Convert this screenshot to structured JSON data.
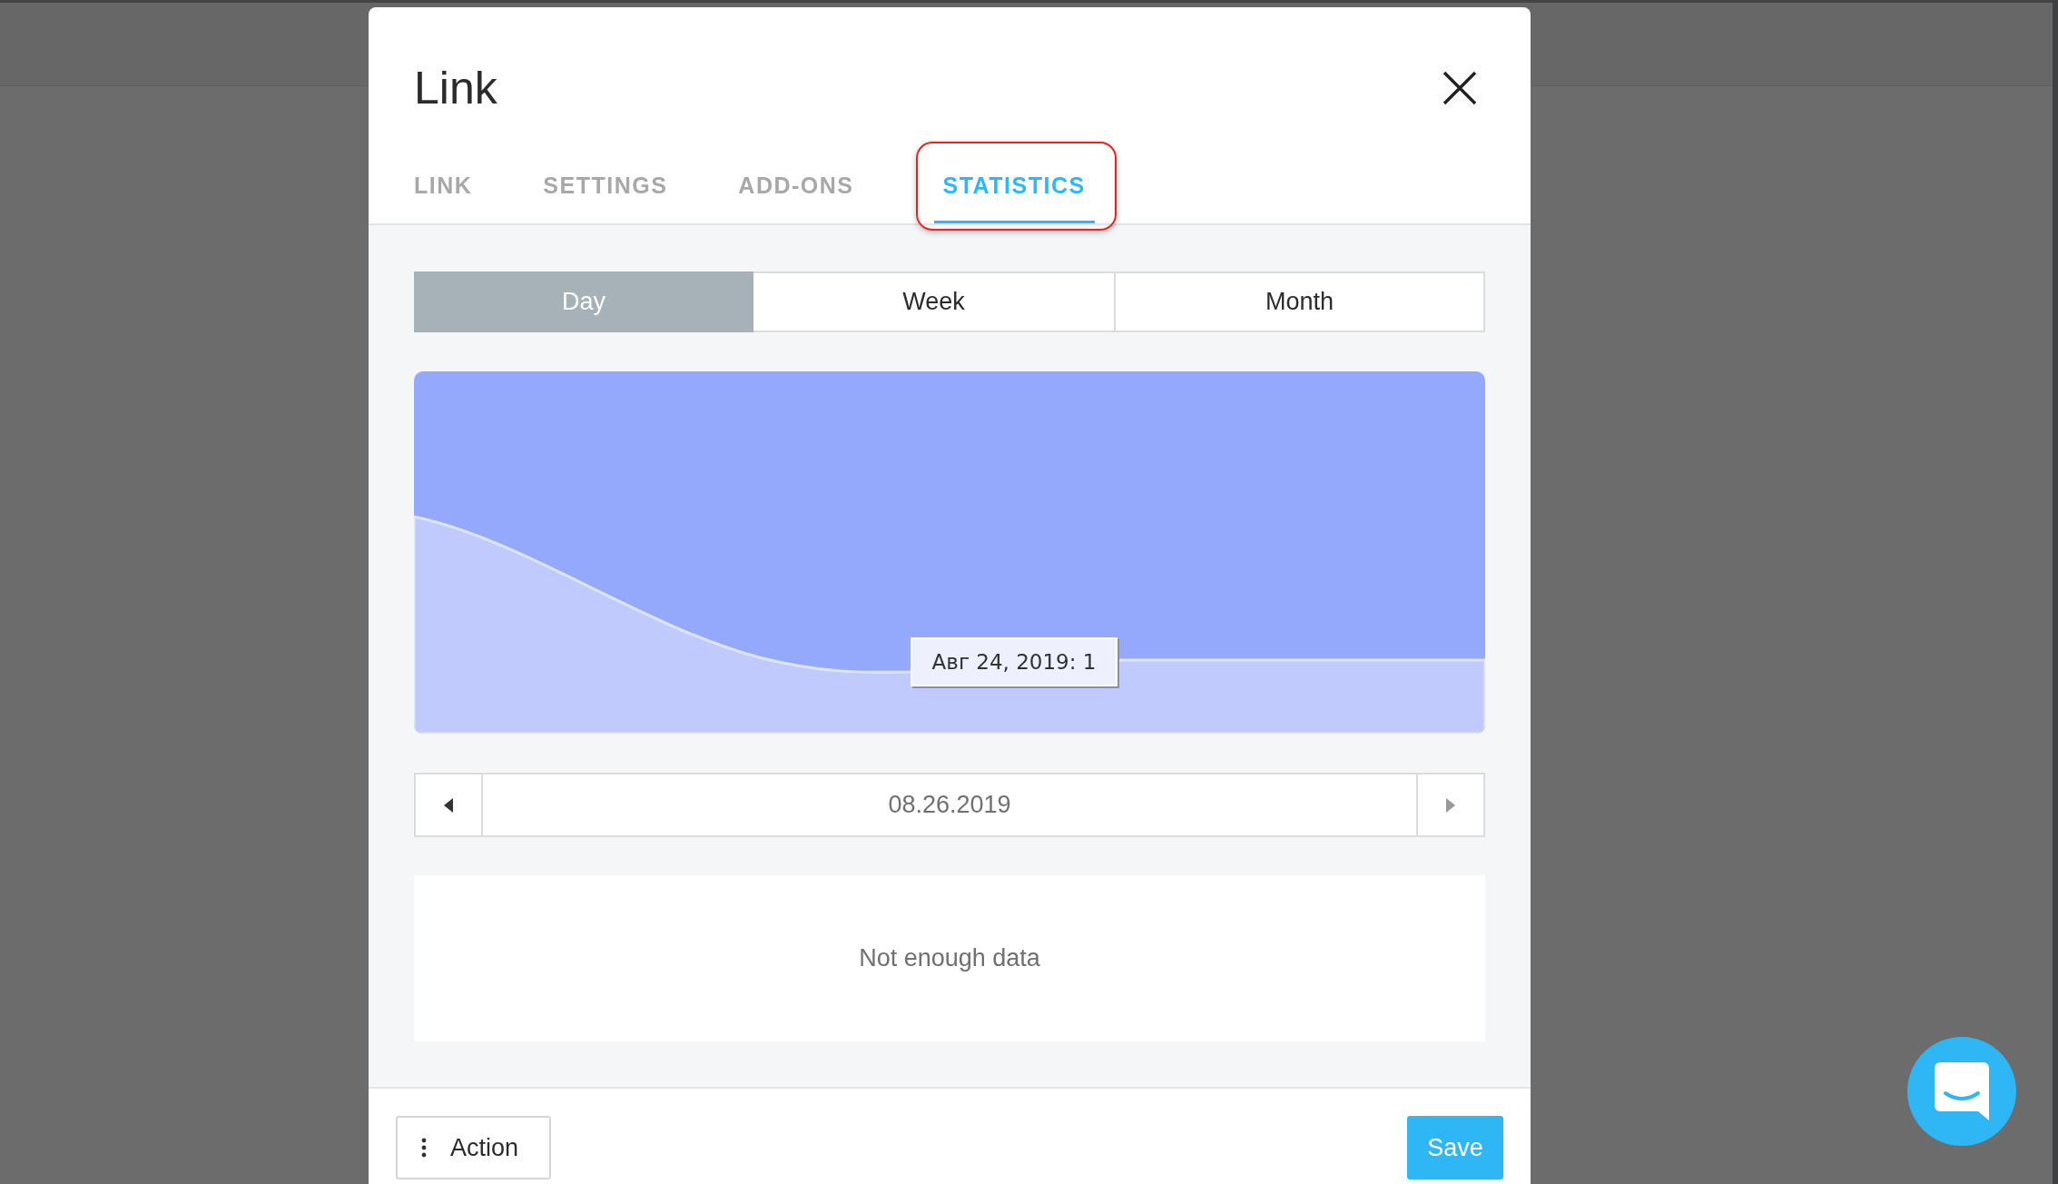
{
  "dialog": {
    "title": "Link"
  },
  "tabs": [
    {
      "label": "LINK",
      "selected": false
    },
    {
      "label": "SETTINGS",
      "selected": false
    },
    {
      "label": "ADD-ONS",
      "selected": false
    },
    {
      "label": "STATISTICS",
      "selected": true
    }
  ],
  "periods": [
    {
      "label": "Day",
      "selected": true
    },
    {
      "label": "Week",
      "selected": false
    },
    {
      "label": "Month",
      "selected": false
    }
  ],
  "chart": {
    "tooltip": "Авг 24, 2019: 1"
  },
  "date_nav": {
    "date": "08.26.2019"
  },
  "empty_message": "Not enough data",
  "footer": {
    "action_button": "Action",
    "save_button": "Save"
  }
}
